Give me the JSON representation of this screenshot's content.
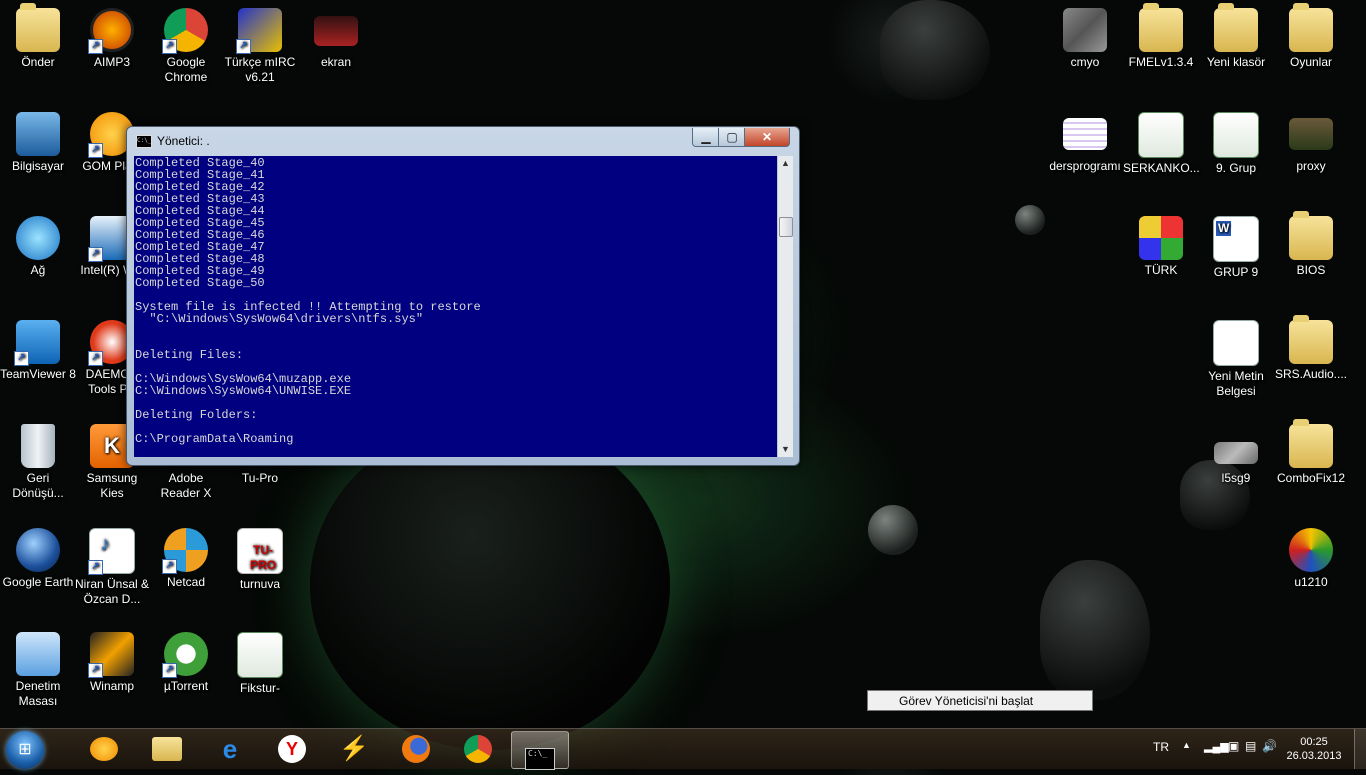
{
  "desktop": {
    "icons": [
      {
        "label": "Önder"
      },
      {
        "label": "AIMP3"
      },
      {
        "label": "Google Chrome"
      },
      {
        "label": "Türkçe mIRC v6.21"
      },
      {
        "label": "ekran"
      },
      {
        "label": "Bilgisayar"
      },
      {
        "label": "GOM Pla..."
      },
      {
        "label": "Ağ"
      },
      {
        "label": "Intel(R) W..."
      },
      {
        "label": "TeamViewer 8"
      },
      {
        "label": "DAEMON Tools P..."
      },
      {
        "label": "Geri Dönüşü..."
      },
      {
        "label": "Samsung Kies"
      },
      {
        "label": "Adobe Reader X"
      },
      {
        "label": "Tu-Pro"
      },
      {
        "label": "Google Earth"
      },
      {
        "label": "Niran Ünsal & Özcan D..."
      },
      {
        "label": "Netcad"
      },
      {
        "label": "turnuva"
      },
      {
        "label": "Denetim Masası"
      },
      {
        "label": "Winamp"
      },
      {
        "label": "µTorrent"
      },
      {
        "label": "Fikstur-"
      },
      {
        "label": "cmyo"
      },
      {
        "label": "FMELv1.3.4"
      },
      {
        "label": "Yeni klasör"
      },
      {
        "label": "Oyunlar"
      },
      {
        "label": "dersprogramı"
      },
      {
        "label": "SERKANKO..."
      },
      {
        "label": "9. Grup"
      },
      {
        "label": "proxy"
      },
      {
        "label": "TÜRK"
      },
      {
        "label": "GRUP 9"
      },
      {
        "label": "BIOS"
      },
      {
        "label": "Yeni Metin Belgesi"
      },
      {
        "label": "SRS.Audio...."
      },
      {
        "label": "l5sg9"
      },
      {
        "label": "ComboFix12"
      },
      {
        "label": "u1210"
      }
    ]
  },
  "console_window": {
    "title": "Yönetici:  .",
    "icon_text": "C:\\_",
    "buttons": {
      "minimize": "▁",
      "maximize": "▢",
      "close": "✕"
    },
    "lines": [
      "Completed Stage_40",
      "Completed Stage_41",
      "Completed Stage_42",
      "Completed Stage_43",
      "Completed Stage_44",
      "Completed Stage_45",
      "Completed Stage_46",
      "Completed Stage_47",
      "Completed Stage_48",
      "Completed Stage_49",
      "Completed Stage_50",
      "",
      "System file is infected !! Attempting to restore",
      "  \"C:\\Windows\\SysWow64\\drivers\\ntfs.sys\"",
      "",
      "",
      "Deleting Files:",
      "",
      "C:\\Windows\\SysWow64\\muzapp.exe",
      "C:\\Windows\\SysWow64\\UNWISE.EXE",
      "",
      "Deleting Folders:",
      "",
      "C:\\ProgramData\\Roaming"
    ]
  },
  "tooltip": {
    "text": "Görev Yöneticisi'ni başlat"
  },
  "taskbar": {
    "language": "TR",
    "time": "00:25",
    "date": "26.03.2013",
    "console_app_text": "C:\\_"
  },
  "colors": {
    "console_bg": "#000080",
    "console_fg": "#D8D8D8"
  }
}
